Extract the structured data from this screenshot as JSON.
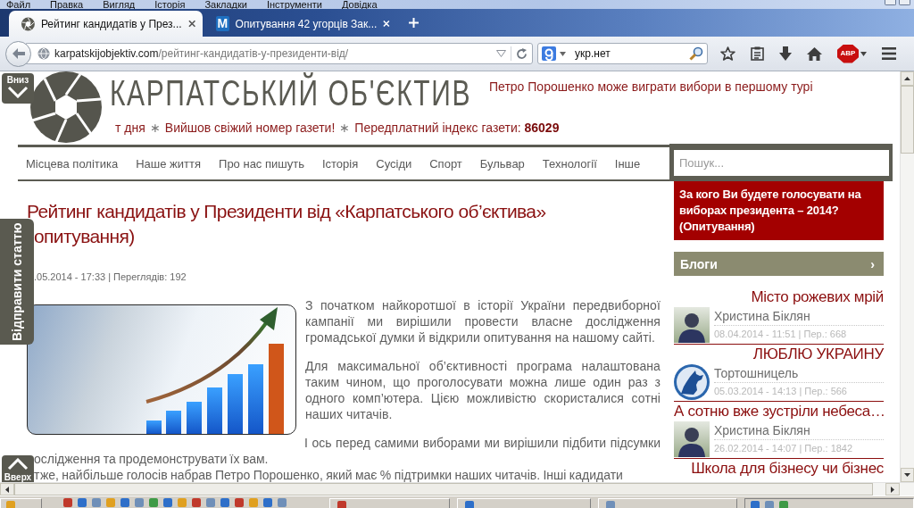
{
  "menu_bar": {
    "items": [
      "Файл",
      "Правка",
      "Вигляд",
      "Історія",
      "Закладки",
      "Інструменти",
      "Довідка"
    ]
  },
  "tabs": [
    {
      "title": "Рейтинг кандидатів у През...",
      "selected": true,
      "kind": "aperture"
    },
    {
      "title": "Опитування 42 угорців Зак...",
      "selected": false,
      "kind": "letter",
      "icon_text": "M"
    }
  ],
  "navigation": {
    "url_domain": "karpatskijobjektiv.com",
    "url_path": "/рейтинг-кандидатів-у-президенти-від/",
    "search_value": "укр.нет",
    "adblock_label": "ABP"
  },
  "site": {
    "logo_text": "КАРПАТСЬКИЙ ОБ'ЄКТИВ",
    "headline": "Петро Порошенко може виграти вибори в першому турі",
    "ticker": [
      {
        "kind": "text",
        "text": "т дня"
      },
      {
        "kind": "separator",
        "text": "∗"
      },
      {
        "kind": "text",
        "text": "Вийшов свіжий номер газети!"
      },
      {
        "kind": "separator",
        "text": "∗"
      },
      {
        "kind": "text",
        "text": "Передплатний індекс газети: **86029**"
      }
    ]
  },
  "floating_buttons": {
    "scroll_down_label": "Вниз",
    "share_label": "Відправити статтю",
    "scroll_up_label": "Вверх"
  },
  "nav_menu": [
    "Місцева політика",
    "Наше життя",
    "Про нас пишуть",
    "Історія",
    "Сусіди",
    "Спорт",
    "Бульвар",
    "Технології",
    "Інше"
  ],
  "search": {
    "placeholder": "Пошук..."
  },
  "article": {
    "title": "Рейтинг кандидатів у Президенти від «Карпатського об’єктива» опитування)",
    "meta": ".05.2014 - 17:33 | Переглядів: 192",
    "paragraphs": [
      [
        "З початком найкоротшої в історії України передвиборної кампанії ми вирішили провести власне дослідження громадської думки й відкрили опитування на нашому сайті."
      ],
      [
        "Для максимальної об’єктивності програма налаштована таким чином, що проголосувати можна лише один раз з одного комп’ютера. Цією можливістю скористалися сотні наших читачів."
      ],
      [
        "І ось перед самими виборами ми вирішили підбити підсумки ослідження та продемонструвати їх вам.",
        "тже, найбільше голосів набрав Петро Порошенко, який має % підтримки наших читачів. Інші кадидати"
      ]
    ]
  },
  "sidebar": {
    "poll": "За кого Ви будете голосувати на виборах президента – 2014? (Опитування)",
    "blogs_header": "Блоги",
    "blogs_arrow": "›",
    "blogs": [
      {
        "kind": "photo",
        "title": "Місто рожевих мрій",
        "author": "Христина Біклян",
        "meta": "08.04.2014 - 11:51 | Пер.: 668"
      },
      {
        "kind": "wolf",
        "title": "ЛЮБЛЮ УКРАИНУ",
        "author": "Тортошницель",
        "meta": "05.03.2014 - 14:13 | Пер.: 566"
      },
      {
        "kind": "photo",
        "title": "А сотню вже зустріли небеса…",
        "author": "Христина Біклян",
        "meta": "26.02.2014 - 14:07 | Пер.: 1842"
      },
      {
        "kind": "title",
        "title": "Школа для бізнесу чи бізнес"
      }
    ]
  }
}
